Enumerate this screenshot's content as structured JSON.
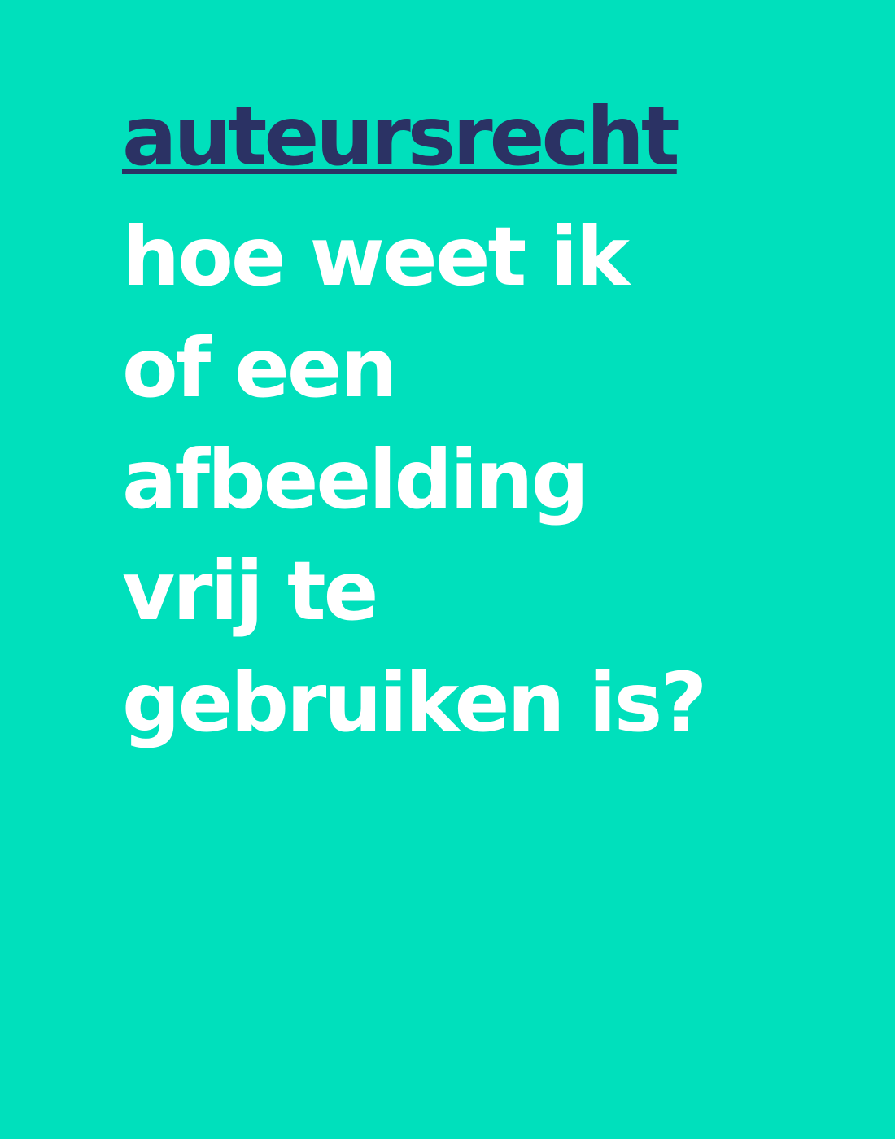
{
  "topic": "auteursrecht",
  "question": {
    "lines": [
      "hoe weet ik",
      "of een",
      "afbeelding",
      "vrij te",
      "gebruiken is?"
    ]
  },
  "colors": {
    "background": "#00e0bc",
    "topic": "#2b3264",
    "question": "#ffffff"
  }
}
